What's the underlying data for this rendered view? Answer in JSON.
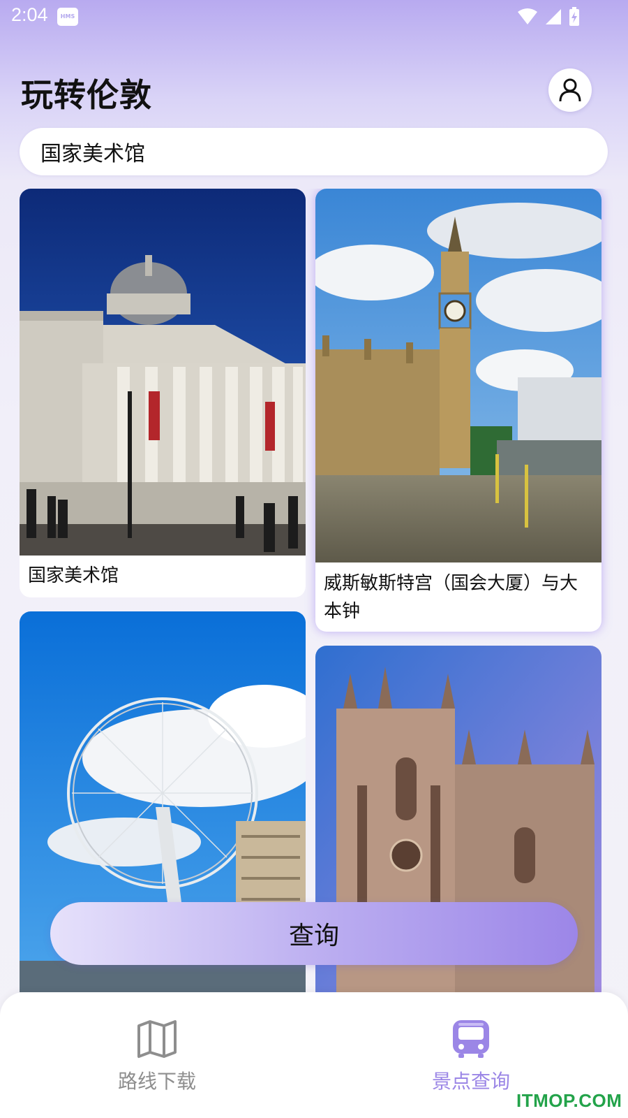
{
  "status_bar": {
    "time": "2:04",
    "hms_badge": "HMS"
  },
  "header": {
    "title": "玩转伦敦",
    "profile_icon": "user-icon"
  },
  "search": {
    "value": "国家美术馆"
  },
  "cards": [
    {
      "label": "国家美术馆",
      "image": "national-gallery-photo"
    },
    {
      "label": "威斯敏斯特宫（国会大厦）与大本钟",
      "image": "big-ben-photo"
    },
    {
      "label": "",
      "image": "london-eye-photo"
    },
    {
      "label": "",
      "image": "westminster-abbey-photo"
    }
  ],
  "query_button": {
    "label": "查询"
  },
  "bottom_nav": {
    "items": [
      {
        "label": "路线下载",
        "icon": "map-icon",
        "active": false,
        "color": "#8e8e8e"
      },
      {
        "label": "景点查询",
        "icon": "bus-icon",
        "active": true,
        "color": "#9b86e6"
      }
    ]
  },
  "watermark": "ITMOP.COM",
  "colors": {
    "accent": "#9b86e6",
    "header_gradient_top": "#b8aaf0"
  }
}
